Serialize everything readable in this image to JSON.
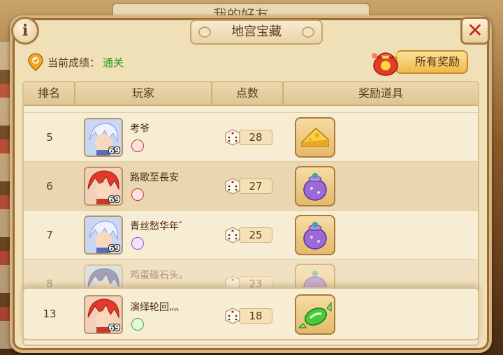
{
  "background": {
    "title_behind": "我的好友"
  },
  "dialog": {
    "title": "地宫宝藏",
    "info_label": "i",
    "close_label": "✕"
  },
  "score": {
    "label": "当前成绩：",
    "value": "通关"
  },
  "rewards_button": {
    "label": "所有奖励"
  },
  "table": {
    "headers": {
      "rank": "排名",
      "player": "玩家",
      "points": "点数",
      "reward": "奖励道具"
    },
    "rows": [
      {
        "rank": "5",
        "name": "考爷",
        "level": "69",
        "points": "28",
        "avatar": "white-hair",
        "reward": "cheese",
        "school": "school-red-icon"
      },
      {
        "rank": "6",
        "name": "路歌至長安",
        "level": "69",
        "points": "27",
        "avatar": "red-hair",
        "reward": "purple-bag",
        "school": "school-red-icon"
      },
      {
        "rank": "7",
        "name": "青丝愁华年゛",
        "level": "69",
        "points": "25",
        "avatar": "white-hair",
        "reward": "purple-bag",
        "school": "school-purple-icon"
      },
      {
        "rank": "8",
        "name": "鸡蛋碰石头。",
        "level": "",
        "points": "23",
        "avatar": "blue-hair",
        "reward": "purple-bag",
        "school": "school-red-icon"
      }
    ],
    "my_row": {
      "rank": "13",
      "name": "演绎轮回灬",
      "level": "69",
      "points": "18",
      "avatar": "red-hair",
      "reward": "green-candy",
      "school": "school-green-icon"
    }
  },
  "colors": {
    "accent_green": "#2f9a1a",
    "close_red": "#c5251b",
    "panel": "#efe0b8"
  }
}
